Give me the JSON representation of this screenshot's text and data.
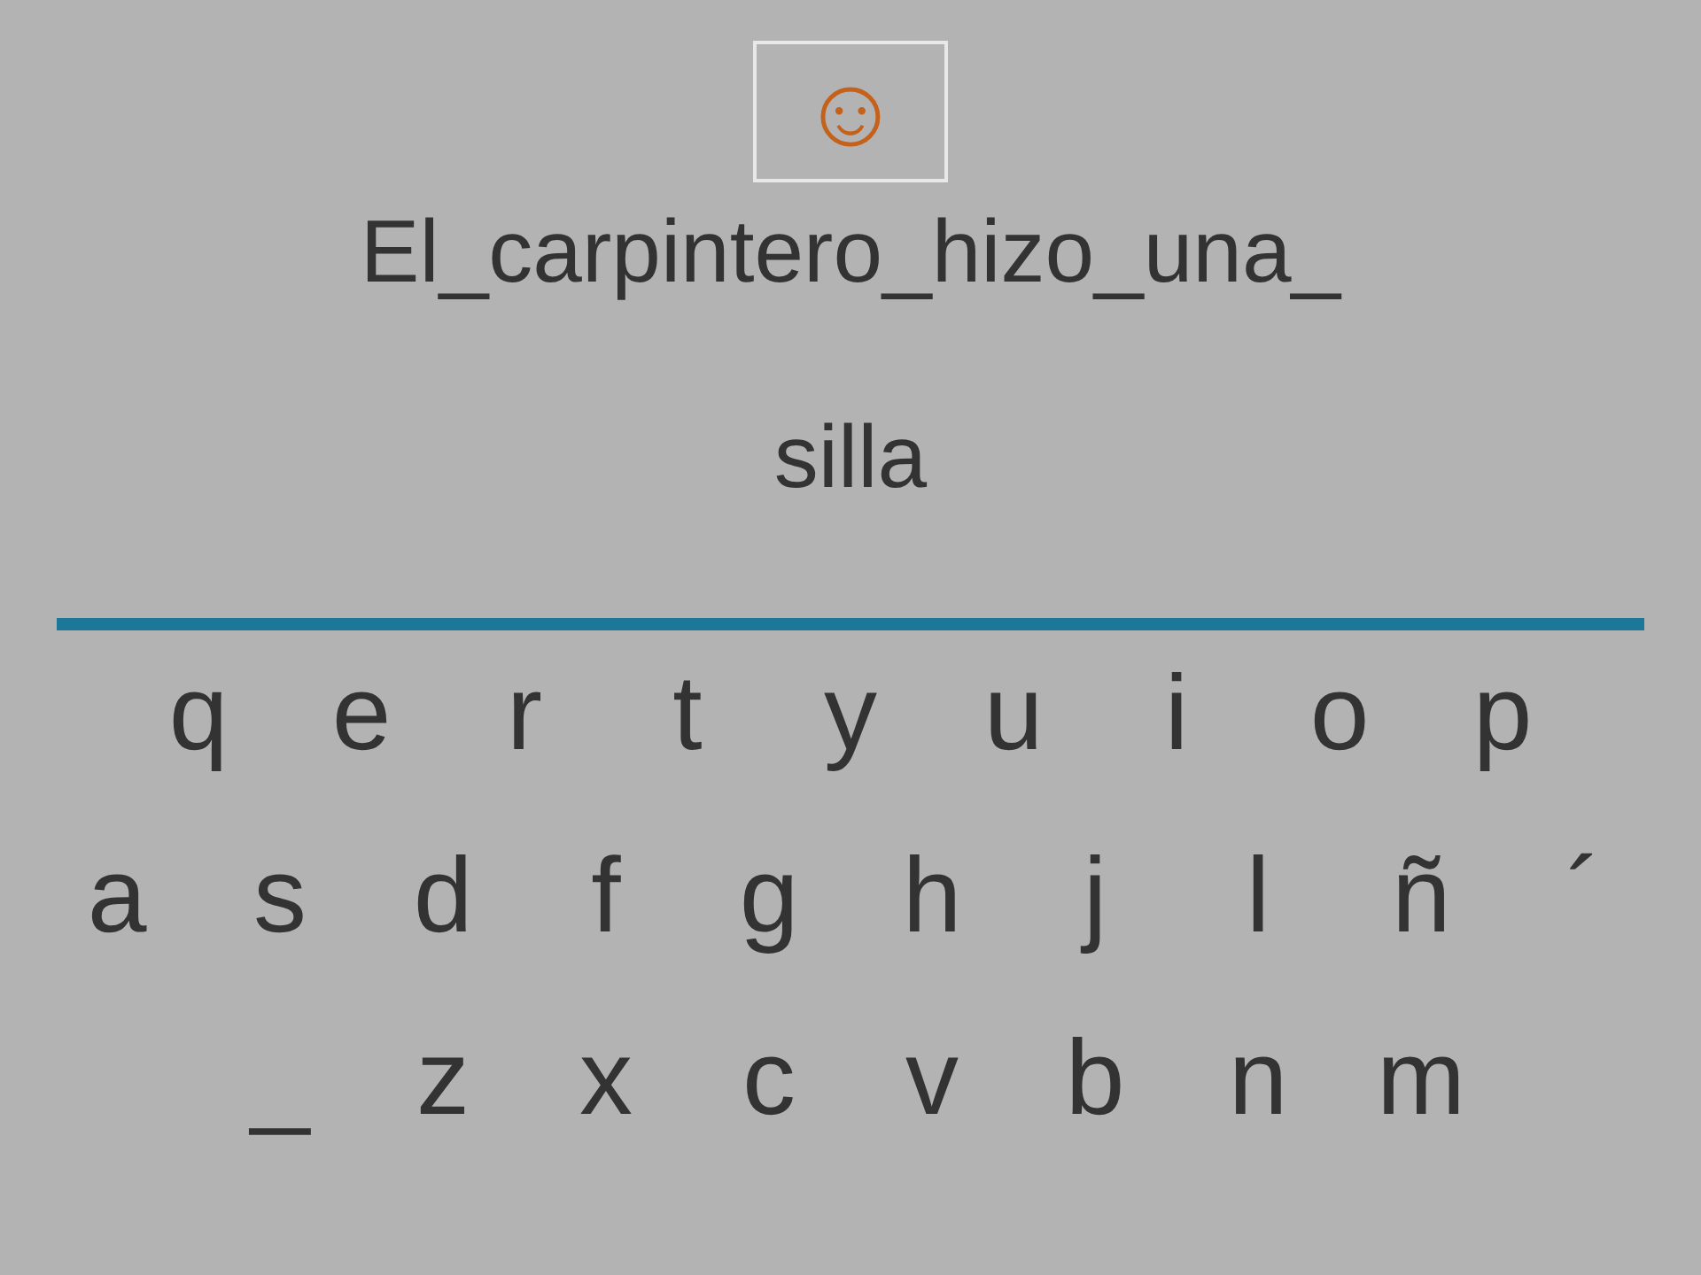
{
  "status_icon": "☺",
  "sentence_lines": [
    "El_carpintero_hizo_una_",
    "silla"
  ],
  "keyboard": {
    "rows": [
      [
        "q",
        "e",
        "r",
        "t",
        "y",
        "u",
        "i",
        "o",
        "p"
      ],
      [
        "a",
        "s",
        "d",
        "f",
        "g",
        "h",
        "j",
        "l",
        "ñ",
        "´"
      ],
      [
        "_",
        "z",
        "x",
        "c",
        "v",
        "b",
        "n",
        "m"
      ]
    ]
  }
}
